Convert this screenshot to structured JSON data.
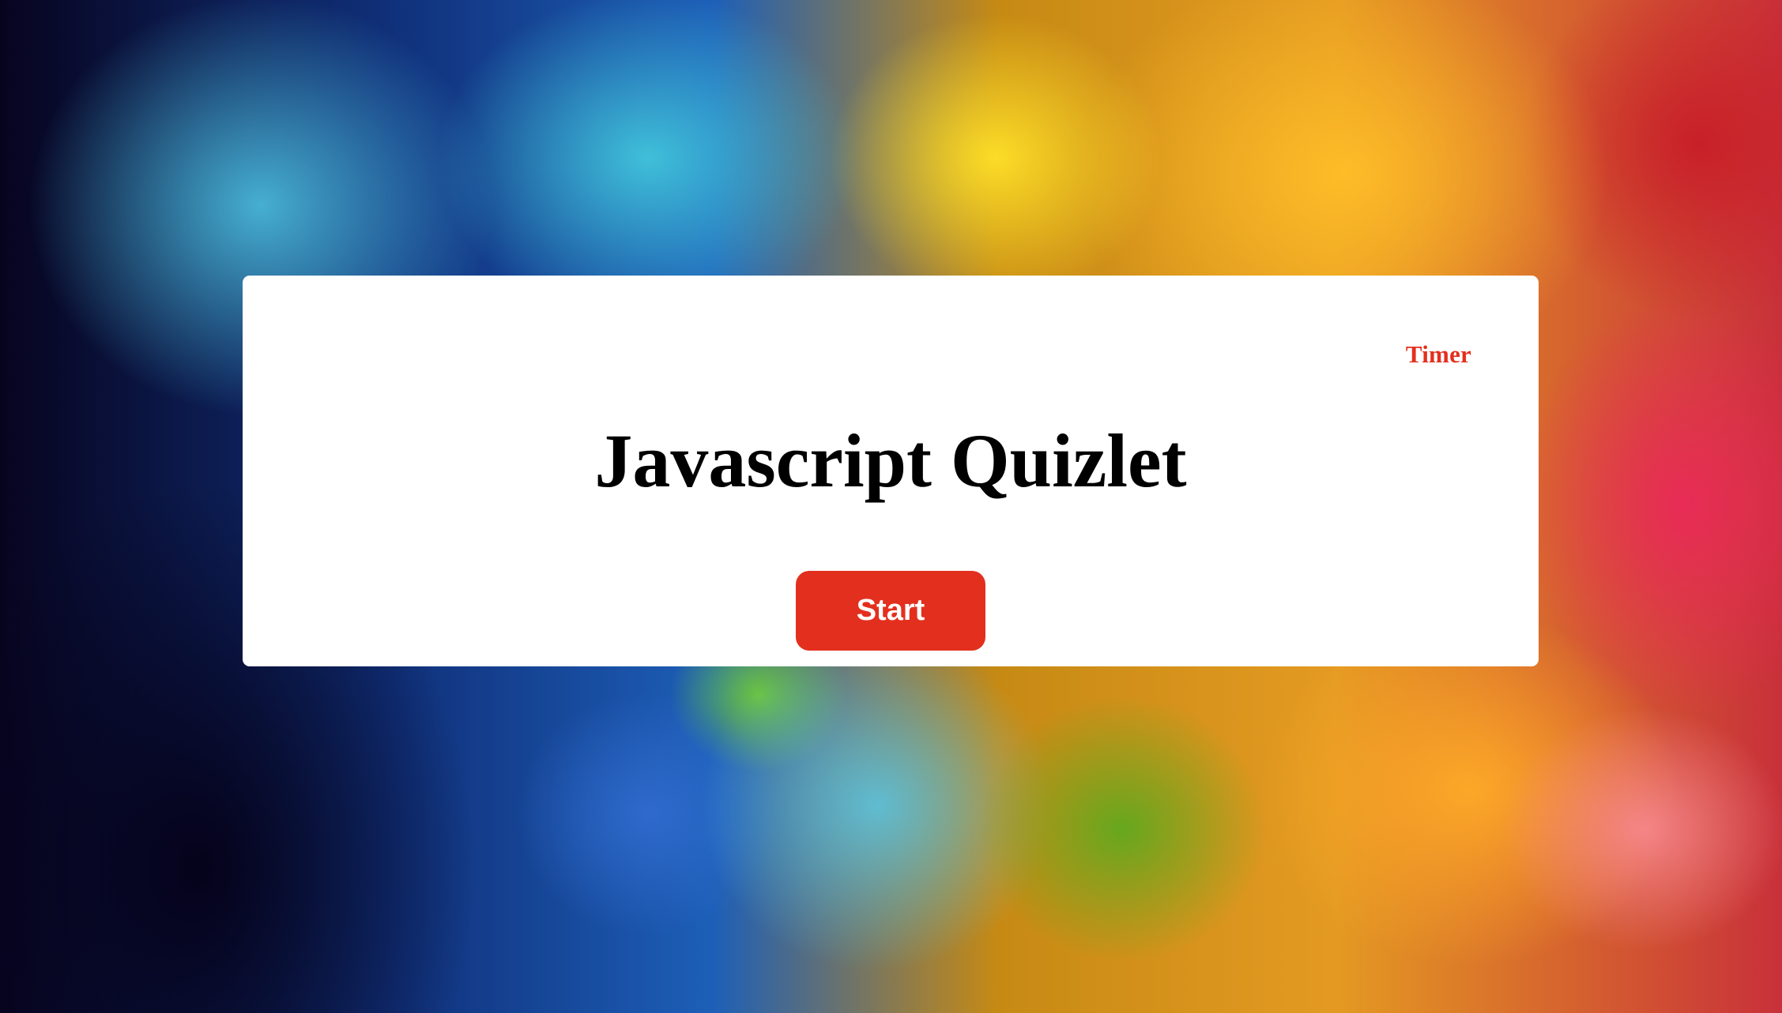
{
  "page": {
    "timer_label": "Timer",
    "title": "Javascript Quizlet",
    "start_button_label": "Start"
  },
  "colors": {
    "accent": "#e3301e",
    "card_background": "#ffffff",
    "title_text": "#000000"
  }
}
